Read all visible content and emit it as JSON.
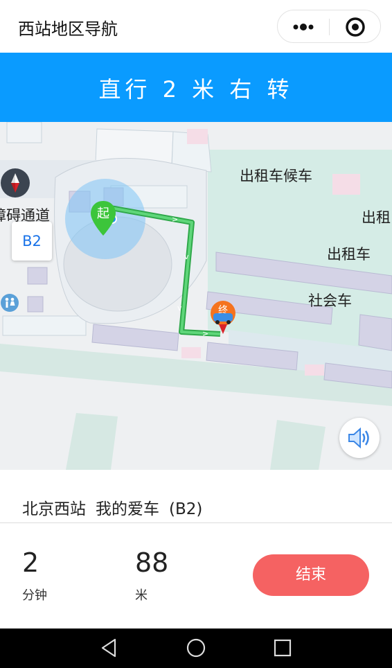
{
  "header": {
    "title": "西站地区导航",
    "more_icon": "more-dots-icon",
    "close_icon": "target-close-icon"
  },
  "guidance": {
    "instruction": "直行 2 米 右 转"
  },
  "map": {
    "labels": {
      "taxi_waiting": "出租车候车",
      "taxi_partial": "出租",
      "taxi": "出租车",
      "social_vehicle": "社会车",
      "accessible_partial": "障碍通道"
    },
    "floor": "B2",
    "start_marker": "起",
    "end_marker": "终",
    "compass_icon": "compass-icon",
    "speaker_icon": "speaker-icon",
    "restroom_icon": "restroom-icon",
    "colors": {
      "route": "#3cc45a",
      "start_marker": "#3cc53b",
      "end_marker": "#f5731f",
      "location_halo": "#7fc4f5"
    }
  },
  "trip": {
    "place": "北京西站",
    "destination": "我的爱车",
    "floor_note": "(B2)",
    "time_value": "2",
    "time_unit": "分钟",
    "distance_value": "88",
    "distance_unit": "米",
    "end_button": "结束"
  },
  "colors": {
    "banner": "#0a9bff",
    "end_button": "#f56262"
  }
}
